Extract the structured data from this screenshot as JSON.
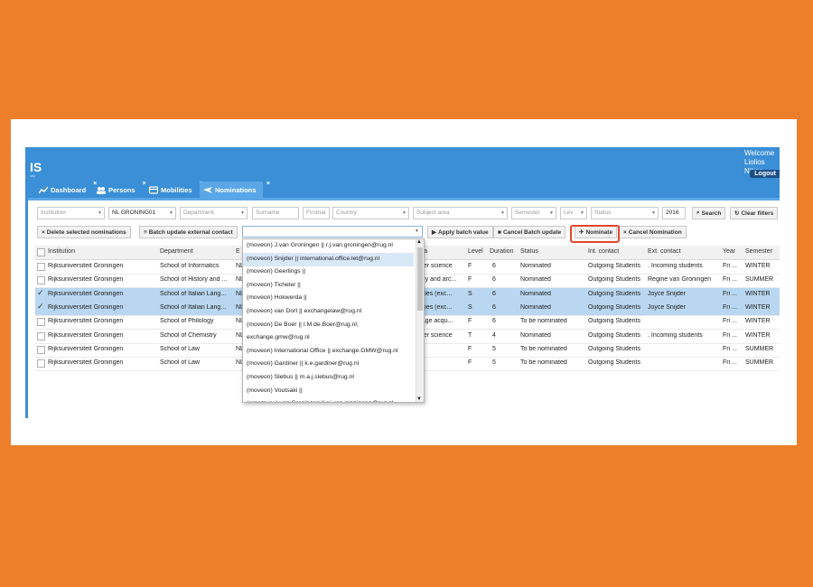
{
  "header": {
    "logo": "IS",
    "logo_sub": "sky",
    "welcome_line1": "Welcome",
    "welcome_line2": "Liolios Nikos",
    "logout": "Logout"
  },
  "tabs": [
    {
      "label": "Dashboard",
      "icon": "chart-line-icon"
    },
    {
      "label": "Persons",
      "icon": "users-icon"
    },
    {
      "label": "Mobilities",
      "icon": "card-icon"
    },
    {
      "label": "Nominations",
      "icon": "plane-icon"
    }
  ],
  "filters": {
    "institution": "Institution",
    "institution_code": "NL GRONING01",
    "department": "Department",
    "surname": "Surname",
    "firstname": "Firstnar",
    "country": "Country",
    "subject_area": "Subject area",
    "semester": "Semester",
    "level": "Lev",
    "status": "Status",
    "year": "2016",
    "search": "Search",
    "clear": "Clear filters"
  },
  "toolbar": {
    "delete_selected": "Delete selected nominations",
    "batch_update": "Batch update external contact",
    "apply_batch": "Apply batch value",
    "cancel_batch": "Cancel Batch update",
    "nominate": "Nominate",
    "cancel_nomination": "Cancel Nomination"
  },
  "columns": [
    "Institution",
    "Department",
    "E",
    "rea",
    "Level",
    "Duration",
    "Status",
    "Int. contact",
    "Ext. contact",
    "Year",
    "Semester"
  ],
  "rows": [
    {
      "selected": false,
      "institution": "Rijksuniversiteit Groningen",
      "department": "School of Informatics",
      "e": "NL",
      "area": "puter science",
      "level": "F",
      "duration": "6",
      "status": "Nominated",
      "int": "Outgoing Students",
      "ext": ". Incoming students",
      "year": "Fri ...",
      "semester": "WINTER"
    },
    {
      "selected": false,
      "institution": "Rijksuniversiteit Groningen",
      "department": "School of History and ...",
      "e": "NL",
      "area": "story and arc...",
      "level": "F",
      "duration": "6",
      "status": "Nominated",
      "int": "Outgoing Students",
      "ext": "Regine van Groningen",
      "year": "Fri ...",
      "semester": "SUMMER"
    },
    {
      "selected": true,
      "institution": "Rijksuniversiteit Groningen",
      "department": "School of Italian Lang...",
      "e": "NL",
      "area": "anities (exc...",
      "level": "S",
      "duration": "6",
      "status": "Nominated",
      "int": "Outgoing Students",
      "ext": "Joyce Snijder",
      "year": "Fri ...",
      "semester": "WINTER"
    },
    {
      "selected": true,
      "institution": "Rijksuniversiteit Groningen",
      "department": "School of Italian Lang...",
      "e": "NL",
      "area": "anities (exc...",
      "level": "S",
      "duration": "6",
      "status": "Nominated",
      "int": "Outgoing Students",
      "ext": "Joyce Snijder",
      "year": "Fri ...",
      "semester": "WINTER"
    },
    {
      "selected": false,
      "institution": "Rijksuniversiteit Groningen",
      "department": "School of Philology",
      "e": "NL",
      "area": "guage acqu...",
      "level": "F",
      "duration": "6",
      "status": "To be nominated",
      "int": "Outgoing Students",
      "ext": "",
      "year": "Fri ...",
      "semester": "WINTER"
    },
    {
      "selected": false,
      "institution": "Rijksuniversiteit Groningen",
      "department": "School of Chemistry",
      "e": "NL",
      "area": "puter science",
      "level": "T",
      "duration": "4",
      "status": "Nominated",
      "int": "Outgoing Students",
      "ext": ". Incoming students",
      "year": "Fri ...",
      "semester": "WINTER"
    },
    {
      "selected": false,
      "institution": "Rijksuniversiteit Groningen",
      "department": "School of Law",
      "e": "NL",
      "area": "",
      "level": "F",
      "duration": "5",
      "status": "To be nominated",
      "int": "Outgoing Students",
      "ext": "",
      "year": "Fri ...",
      "semester": "SUMMER"
    },
    {
      "selected": false,
      "institution": "Rijksuniversiteit Groningen",
      "department": "School of Law",
      "e": "NL",
      "area": "",
      "level": "F",
      "duration": "5",
      "status": "To be nominated",
      "int": "Outgoing Students",
      "ext": "",
      "year": "Fri ...",
      "semester": "SUMMER"
    }
  ],
  "dropdown": [
    "(moveon) J.van Groningen || r.j.van.groningen@rug.nl",
    "(moveon) Snijder || international.office.let@rug.nl",
    "(moveon) Geerlings ||",
    "(moveon) Ticheler ||",
    "(moveon) Hokwerda ||",
    "(moveon) van Dort || exchangelaw@rug.nl",
    "(moveon) De Boer || I.M.de.Boer@rug.nl;",
    "exchange.gmw@rug.nl",
    "(moveon) International Office || exchange.GMW@rug.nl",
    "(moveon) Gardiner || k.e.gardiner@rug.nl",
    "(moveon) Slebus || m.a.j.slebus@rug.nl",
    "(moveon) Voutsaki ||",
    "(erasmus+) van Groningen || r.j.van.groningen@rug.nl"
  ]
}
